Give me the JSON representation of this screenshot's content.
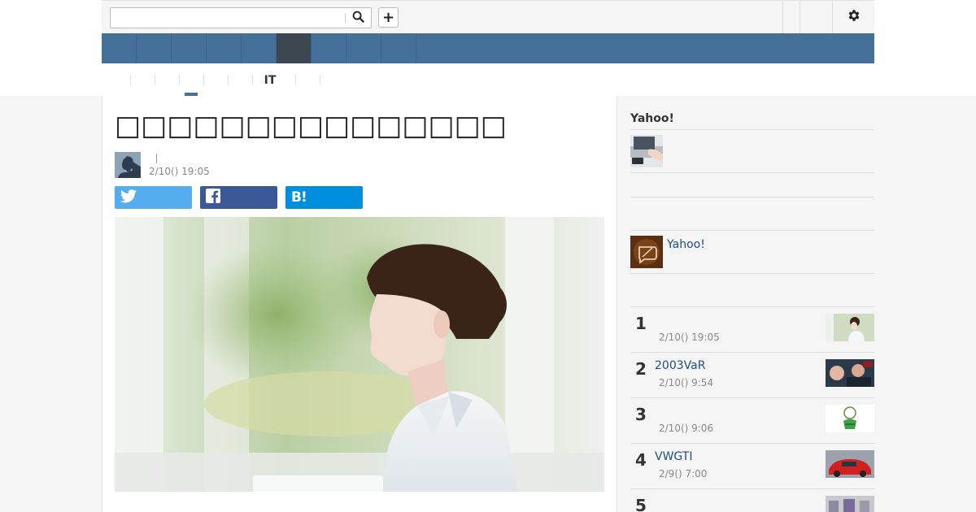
{
  "header": {
    "search": {
      "value": "",
      "placeholder": ""
    }
  },
  "nav": {
    "tab_count": 9,
    "active_index": 5
  },
  "subnav": {
    "items": [
      "",
      "",
      "",
      "",
      "",
      "",
      "IT",
      "",
      ""
    ],
    "active_index": 3
  },
  "article": {
    "title": "□□□□□□□□□□□□□□□",
    "author_name": "",
    "date": "2/10() 19:05",
    "share": {
      "twitter_label": "",
      "facebook_label": "",
      "hatena_label": "B!"
    }
  },
  "sidebar": {
    "heading": "Yahoo!",
    "promo_link": "Yahoo!",
    "ranking": [
      {
        "rank": "1",
        "title": "",
        "date": "2/10() 19:05"
      },
      {
        "rank": "2",
        "title": "2003VaR",
        "date": "2/10() 9:54"
      },
      {
        "rank": "3",
        "title": "",
        "date": "2/10() 9:06"
      },
      {
        "rank": "4",
        "title": "VWGTI",
        "date": "2/9() 7:00"
      },
      {
        "rank": "5",
        "title": "",
        "date": ""
      }
    ]
  },
  "colors": {
    "nav_blue": "#44709a",
    "nav_active": "#3c4752",
    "twitter": "#55acee",
    "facebook": "#3b5998",
    "hatena": "#008fde",
    "link": "#1a4c8c"
  }
}
